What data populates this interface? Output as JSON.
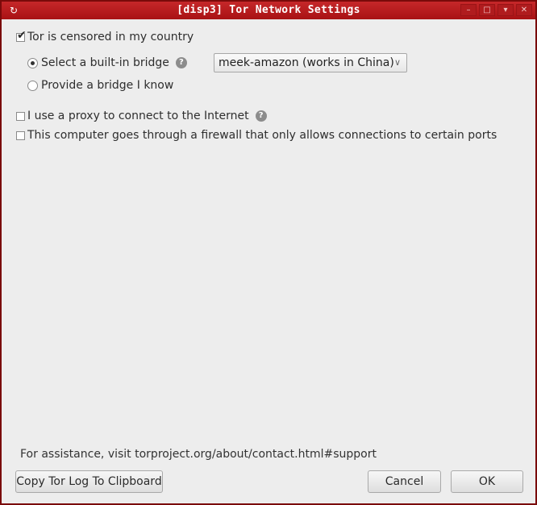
{
  "window": {
    "title": "[disp3] Tor Network Settings",
    "icon": "refresh-icon",
    "controls": [
      "minimize",
      "maximize",
      "shade",
      "close"
    ]
  },
  "options": {
    "censored": {
      "label": "Tor is censored in my country",
      "checked": true
    },
    "builtin_bridge": {
      "label": "Select a built-in bridge",
      "selected": true
    },
    "bridge_select": {
      "value": "meek-amazon (works in China)"
    },
    "custom_bridge": {
      "label": "Provide a bridge I know",
      "selected": false
    },
    "proxy": {
      "label": "I use a proxy to connect to the Internet",
      "checked": false
    },
    "firewall": {
      "label": "This computer goes through a firewall that only allows connections to certain ports",
      "checked": false
    }
  },
  "help_icon_text": "?",
  "footer": {
    "assistance": "For assistance, visit torproject.org/about/contact.html#support",
    "copy_log_label": "Copy Tor Log To Clipboard",
    "cancel_label": "Cancel",
    "ok_label": "OK"
  }
}
